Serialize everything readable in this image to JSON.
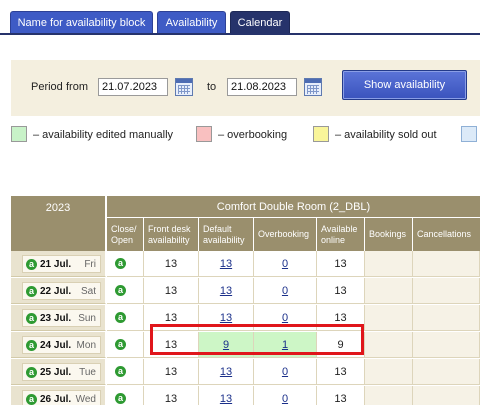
{
  "tabs": [
    {
      "label": "Name for availability block",
      "active": false
    },
    {
      "label": "Availability",
      "active": false
    },
    {
      "label": "Calendar",
      "active": true
    }
  ],
  "filter": {
    "period_label": "Period",
    "from_label": "from",
    "from_value": "21.07.2023",
    "to_label": "to",
    "to_value": "21.08.2023",
    "show_button": "Show availability"
  },
  "legend": [
    {
      "label": "– availability edited manually",
      "color": "#c8f2c8"
    },
    {
      "label": "– overbooking",
      "color": "#f9c0c0"
    },
    {
      "label": "– availability sold out",
      "color": "#f9f59a"
    },
    {
      "label": "",
      "color": "#dceaf8"
    }
  ],
  "table": {
    "year": "2023",
    "room": "Comfort Double Room (2_DBL)",
    "columns": [
      {
        "line1": "Close/",
        "line2": "Open"
      },
      {
        "line1": "Front desk",
        "line2": "availability"
      },
      {
        "line1": "Default",
        "line2": "availability"
      },
      {
        "line1": "Overbooking",
        "line2": ""
      },
      {
        "line1": "Available",
        "line2": "online"
      },
      {
        "line1": "Bookings",
        "line2": ""
      },
      {
        "line1": "Cancellations",
        "line2": ""
      }
    ],
    "status_icon": "a",
    "rows": [
      {
        "day": "21 Jul.",
        "weekday": "Fri",
        "front_desk": "13",
        "default": "13",
        "overbooking": "0",
        "online": "13",
        "bookings": "",
        "cancellations": "",
        "edited": false
      },
      {
        "day": "22 Jul.",
        "weekday": "Sat",
        "front_desk": "13",
        "default": "13",
        "overbooking": "0",
        "online": "13",
        "bookings": "",
        "cancellations": "",
        "edited": false
      },
      {
        "day": "23 Jul.",
        "weekday": "Sun",
        "front_desk": "13",
        "default": "13",
        "overbooking": "0",
        "online": "13",
        "bookings": "",
        "cancellations": "",
        "edited": false
      },
      {
        "day": "24 Jul.",
        "weekday": "Mon",
        "front_desk": "13",
        "default": "9",
        "overbooking": "1",
        "online": "9",
        "bookings": "",
        "cancellations": "",
        "edited": true
      },
      {
        "day": "25 Jul.",
        "weekday": "Tue",
        "front_desk": "13",
        "default": "13",
        "overbooking": "0",
        "online": "13",
        "bookings": "",
        "cancellations": "",
        "edited": false
      },
      {
        "day": "26 Jul.",
        "weekday": "Wed",
        "front_desk": "13",
        "default": "13",
        "overbooking": "0",
        "online": "13",
        "bookings": "",
        "cancellations": "",
        "edited": false
      }
    ]
  }
}
